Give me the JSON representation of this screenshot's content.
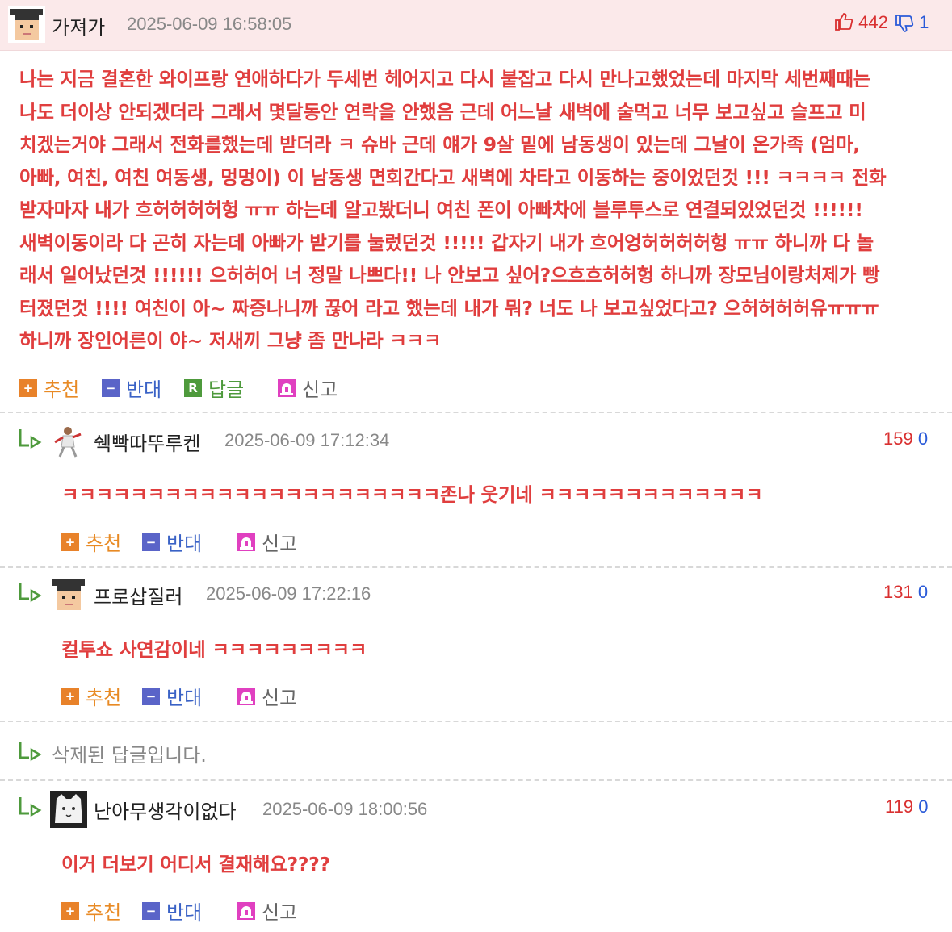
{
  "post": {
    "nickname": "가져가",
    "date": "2025-06-09 16:58:05",
    "up_count": "442",
    "down_count": "1",
    "body_lines": [
      "나는 지금 결혼한 와이프랑 연애하다가 두세번 헤어지고 다시 붙잡고 다시 만나고했었는데 마지막 세번째때는",
      "나도 더이상 안되겠더라 그래서 몇달동안 연락을 안했음 근데 어느날 새벽에 술먹고 너무 보고싶고 슬프고 미",
      "치겠는거야 그래서 전화를했는데 받더라 ㅋ 슈바 근데 얘가 9살 밑에 남동생이 있는데 그날이 온가족 (엄마,",
      "아빠, 여친, 여친 여동생, 멍멍이) 이 남동생 면회간다고 새벽에 차타고 이동하는 중이었던것 !!! ㅋㅋㅋㅋ 전화",
      "받자마자 내가 흐허허허허헝 ㅠㅠ 하는데 알고봤더니 여친 폰이 아빠차에 블루투스로 연결되있었던것 !!!!!!",
      "새벽이동이라 다 곤히 자는데 아빠가 받기를 눌렀던것 !!!!! 갑자기 내가 흐어엉허허허허헝 ㅠㅠ 하니까 다 놀",
      "래서 일어났던것 !!!!!! 으허허어 너 정말 나쁘다!! 나 안보고 싶어?으흐흐허허헝 하니까 장모님이랑처제가 빵",
      "터졌던것 !!!! 여친이 아~ 짜증나니까 끊어 라고 했는데 내가 뭐? 너도 나 보고싶었다고? 으허허허허유ㅠㅠㅠ",
      "하니까 장인어른이 야~ 저새끼 그냥 좀 만나라 ㅋㅋㅋ"
    ],
    "actions": {
      "recommend": "추천",
      "oppose": "반대",
      "reply": "답글",
      "report": "신고"
    }
  },
  "comments": [
    {
      "nickname": "쉑빡따뚜루켄",
      "date": "2025-06-09 17:12:34",
      "up_count": "159",
      "down_count": "0",
      "text": "ㅋㅋㅋㅋㅋㅋㅋㅋㅋㅋㅋㅋㅋㅋㅋㅋㅋㅋㅋㅋㅋㅋ존나 웃기네 ㅋㅋㅋㅋㅋㅋㅋㅋㅋㅋㅋㅋㅋ",
      "actions": {
        "recommend": "추천",
        "oppose": "반대",
        "report": "신고"
      }
    },
    {
      "nickname": "프로삽질러",
      "date": "2025-06-09 17:22:16",
      "up_count": "131",
      "down_count": "0",
      "text": "컬투쇼 사연감이네 ㅋㅋㅋㅋㅋㅋㅋㅋㅋ",
      "actions": {
        "recommend": "추천",
        "oppose": "반대",
        "report": "신고"
      }
    },
    {
      "deleted_text": "삭제된 답글입니다."
    },
    {
      "nickname": "난아무생각이없다",
      "date": "2025-06-09 18:00:56",
      "up_count": "119",
      "down_count": "0",
      "text": "이거 더보기 어디서 결재해요????",
      "actions": {
        "recommend": "추천",
        "oppose": "반대",
        "report": "신고"
      }
    }
  ]
}
